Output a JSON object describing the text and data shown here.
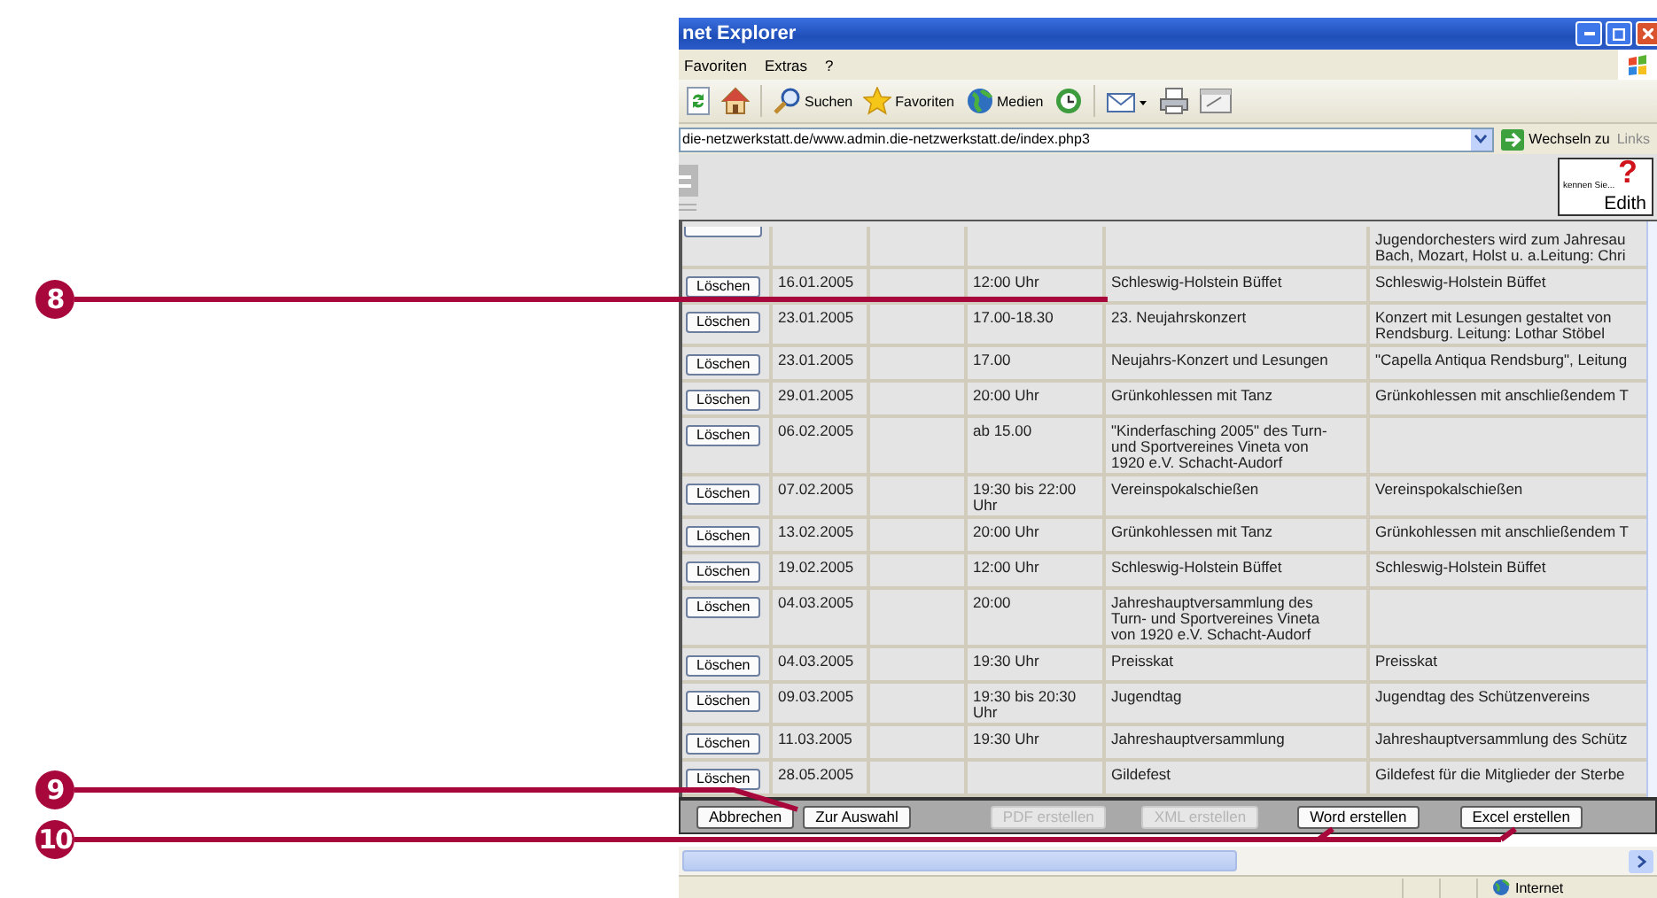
{
  "callouts": [
    {
      "number": "8"
    },
    {
      "number": "9"
    },
    {
      "number": "10"
    }
  ],
  "window": {
    "title": "net Explorer"
  },
  "menu": [
    "Favoriten",
    "Extras",
    "?"
  ],
  "toolbar": {
    "search_label": "Suchen",
    "favorites_label": "Favoriten",
    "media_label": "Medien"
  },
  "address_bar": {
    "value": "die-netzwerkstatt.de/www.admin.die-netzwerkstatt.de/index.php3",
    "go_label": "Wechseln zu",
    "links_label": "Links"
  },
  "header": {
    "logo_caption": "kennen Sie...",
    "logo_mark": "?",
    "logo_name": "Edith"
  },
  "table": {
    "rows": [
      {
        "description": "Jugendorchesters wird zum Jahresau\nBach, Mozart, Holst u. a.Leitung: Chri"
      },
      {
        "action": "Löschen",
        "date": "16.01.2005",
        "time": "12:00 Uhr",
        "title": "Schleswig-Holstein Büffet",
        "description": "Schleswig-Holstein Büffet"
      },
      {
        "action": "Löschen",
        "date": "23.01.2005",
        "time": "17.00-18.30",
        "title": "23. Neujahrskonzert",
        "description": "Konzert mit Lesungen gestaltet von\nRendsburg. Leitung: Lothar Stöbel"
      },
      {
        "action": "Löschen",
        "date": "23.01.2005",
        "time": "17.00",
        "title": "Neujahrs-Konzert und Lesungen",
        "description": "\"Capella Antiqua Rendsburg\", Leitung"
      },
      {
        "action": "Löschen",
        "date": "29.01.2005",
        "time": "20:00 Uhr",
        "title": "Grünkohlessen mit Tanz",
        "description": "Grünkohlessen mit anschließendem T"
      },
      {
        "action": "Löschen",
        "date": "06.02.2005",
        "time": "ab 15.00",
        "title": "\"Kinderfasching 2005\" des Turn-\nund Sportvereines Vineta von\n1920 e.V. Schacht-Audorf"
      },
      {
        "action": "Löschen",
        "date": "07.02.2005",
        "time": "19:30 bis 22:00\nUhr",
        "title": "Vereinspokalschießen",
        "description": "Vereinspokalschießen"
      },
      {
        "action": "Löschen",
        "date": "13.02.2005",
        "time": "20:00 Uhr",
        "title": "Grünkohlessen mit Tanz",
        "description": "Grünkohlessen mit anschließendem T"
      },
      {
        "action": "Löschen",
        "date": "19.02.2005",
        "time": "12:00 Uhr",
        "title": "Schleswig-Holstein Büffet",
        "description": "Schleswig-Holstein Büffet"
      },
      {
        "action": "Löschen",
        "date": "04.03.2005",
        "time": "20:00",
        "title": "Jahreshauptversammlung des\nTurn- und Sportvereines Vineta\nvon 1920 e.V. Schacht-Audorf"
      },
      {
        "action": "Löschen",
        "date": "04.03.2005",
        "time": "19:30 Uhr",
        "title": "Preisskat",
        "description": "Preisskat"
      },
      {
        "action": "Löschen",
        "date": "09.03.2005",
        "time": "19:30 bis 20:30\nUhr",
        "title": "Jugendtag",
        "description": "Jugendtag des Schützenvereins"
      },
      {
        "action": "Löschen",
        "date": "11.03.2005",
        "time": "19:30 Uhr",
        "title": "Jahreshauptversammlung",
        "description": "Jahreshauptversammlung des Schütz"
      },
      {
        "action": "Löschen",
        "date": "28.05.2005",
        "title": "Gildefest",
        "description": "Gildefest für die Mitglieder der Sterbe"
      }
    ]
  },
  "footer_buttons": [
    {
      "label": "Abbrechen",
      "disabled": false
    },
    {
      "label": "Zur Auswahl",
      "disabled": false
    },
    {
      "label": "PDF erstellen",
      "disabled": true
    },
    {
      "label": "XML erstellen",
      "disabled": true
    },
    {
      "label": "Word erstellen",
      "disabled": false
    },
    {
      "label": "Excel erstellen",
      "disabled": false
    }
  ],
  "status_bar": {
    "zone": "Internet"
  }
}
